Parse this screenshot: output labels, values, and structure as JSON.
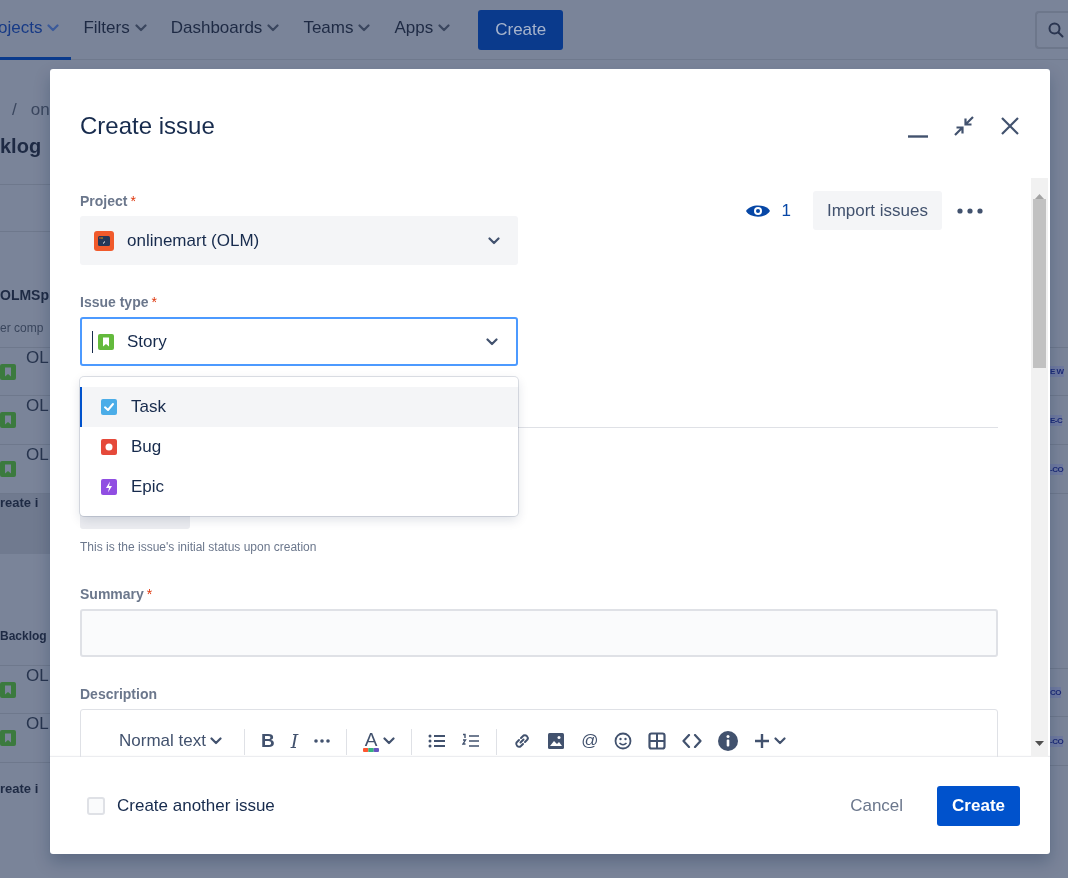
{
  "top_nav": {
    "items": [
      {
        "label": "ojects",
        "selected": true
      },
      {
        "label": "Filters",
        "selected": false
      },
      {
        "label": "Dashboards",
        "selected": false
      },
      {
        "label": "Teams",
        "selected": false
      },
      {
        "label": "Apps",
        "selected": false
      }
    ],
    "create_button": "Create"
  },
  "background_page": {
    "breadcrumb_separator": "/",
    "breadcrumb": "on",
    "heading": "klog",
    "sprint": "OLMSp",
    "sprint_meta": "er comp",
    "sprint_rows": [
      {
        "key": "OL",
        "tag": "E W"
      },
      {
        "key": "OL",
        "tag": "E-C"
      },
      {
        "key": "OL",
        "tag": "-CO"
      }
    ],
    "create_row": "reate i",
    "backlog": "Backlog",
    "backlog_rows": [
      {
        "key": "OL",
        "tag": "CO"
      },
      {
        "key": "OL",
        "tag": "-CO"
      }
    ],
    "create_row_2": "reate i"
  },
  "dialog": {
    "title": "Create issue",
    "watchers": "1",
    "import_button": "Import issues",
    "project": {
      "label": "Project",
      "required_mark": "*",
      "value": "onlinemart (OLM)"
    },
    "issue_type": {
      "label": "Issue type",
      "required_mark": "*",
      "value": "Story",
      "focused": true,
      "options": [
        {
          "kind": "task",
          "label": "Task",
          "selected": true
        },
        {
          "kind": "bug",
          "label": "Bug",
          "selected": false
        },
        {
          "kind": "epic",
          "label": "Epic",
          "selected": false
        }
      ]
    },
    "status_help": "This is the issue's initial status upon creation",
    "summary": {
      "label": "Summary",
      "required_mark": "*"
    },
    "description": {
      "label": "Description",
      "toolbar": {
        "text_style": "Normal text",
        "bold": "B",
        "italic": "I",
        "text_color": "A",
        "mention": "@"
      }
    },
    "create_another": {
      "label": "Create another issue",
      "checked": false
    },
    "cancel_button": "Cancel",
    "create_button": "Create"
  }
}
